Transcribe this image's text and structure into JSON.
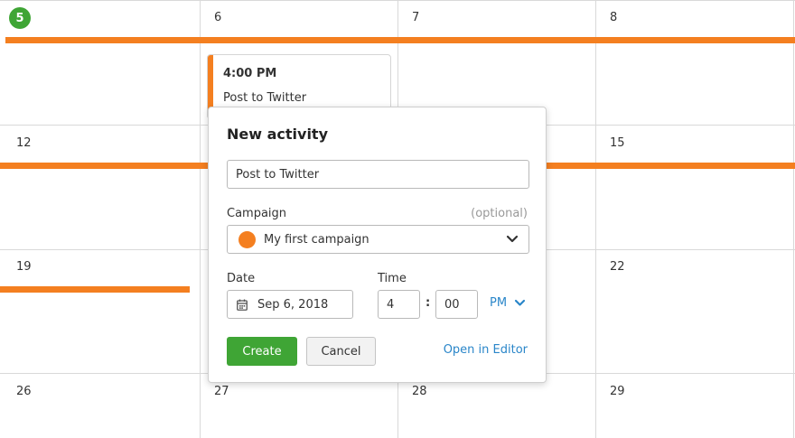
{
  "calendar": {
    "days": [
      "5",
      "6",
      "7",
      "8",
      "12",
      "15",
      "19",
      "22",
      "26",
      "27",
      "28",
      "29"
    ],
    "accent_color": "#f47f20",
    "today_color": "#3fa535"
  },
  "event": {
    "time": "4:00 PM",
    "title": "Post to Twitter"
  },
  "popup": {
    "title": "New activity",
    "title_input_value": "Post to Twitter",
    "campaign_label": "Campaign",
    "campaign_optional": "(optional)",
    "campaign_value": "My first campaign",
    "campaign_color": "#f47f20",
    "date_label": "Date",
    "date_value": "Sep 6, 2018",
    "time_label": "Time",
    "time_hour": "4",
    "time_separator": ":",
    "time_minute": "00",
    "time_ampm": "PM",
    "create_label": "Create",
    "cancel_label": "Cancel",
    "open_editor_label": "Open in Editor"
  }
}
